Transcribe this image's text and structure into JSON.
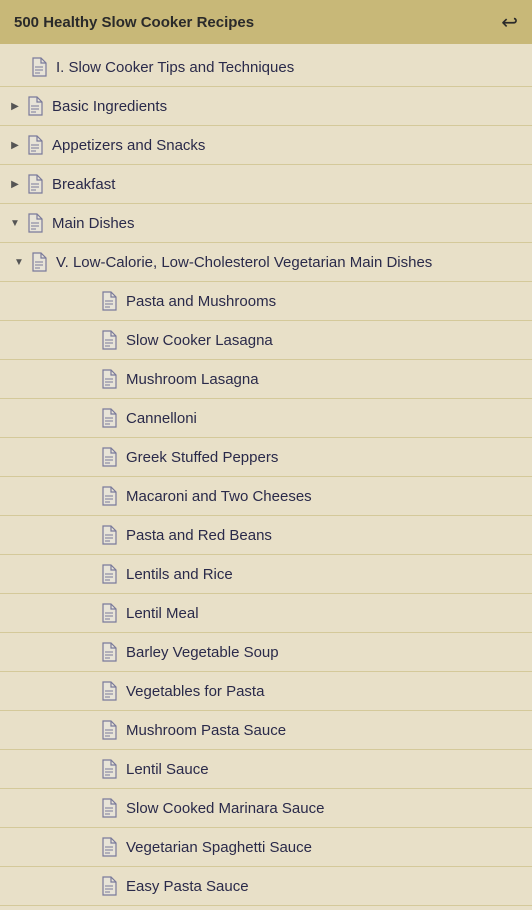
{
  "header": {
    "title": "500 Healthy Slow Cooker Recipes",
    "back_label": "↩"
  },
  "tree": [
    {
      "id": "tips",
      "label": "I. Slow Cooker Tips and Techniques",
      "indent": 1,
      "arrow": "none",
      "hasDoc": true
    },
    {
      "id": "basic-ingredients",
      "label": "Basic Ingredients",
      "indent": 0,
      "arrow": "right",
      "hasDoc": true
    },
    {
      "id": "appetizers",
      "label": "Appetizers and Snacks",
      "indent": 0,
      "arrow": "right",
      "hasDoc": true
    },
    {
      "id": "breakfast",
      "label": "Breakfast",
      "indent": 0,
      "arrow": "right",
      "hasDoc": true
    },
    {
      "id": "main-dishes",
      "label": "Main Dishes",
      "indent": 0,
      "arrow": "down",
      "hasDoc": true
    },
    {
      "id": "vegetarian-main",
      "label": "V. Low-Calorie, Low-Cholesterol Vegetarian Main Dishes",
      "indent": 1,
      "arrow": "down",
      "hasDoc": true
    },
    {
      "id": "pasta-mushrooms",
      "label": "Pasta and Mushrooms",
      "indent": 2,
      "arrow": "none",
      "hasDoc": true
    },
    {
      "id": "slow-cooker-lasagna",
      "label": "Slow Cooker Lasagna",
      "indent": 2,
      "arrow": "none",
      "hasDoc": true
    },
    {
      "id": "mushroom-lasagna",
      "label": "Mushroom Lasagna",
      "indent": 2,
      "arrow": "none",
      "hasDoc": true
    },
    {
      "id": "cannelloni",
      "label": "Cannelloni",
      "indent": 2,
      "arrow": "none",
      "hasDoc": true
    },
    {
      "id": "greek-stuffed-peppers",
      "label": "Greek Stuffed Peppers",
      "indent": 2,
      "arrow": "none",
      "hasDoc": true
    },
    {
      "id": "macaroni-two-cheeses",
      "label": "Macaroni and Two Cheeses",
      "indent": 2,
      "arrow": "none",
      "hasDoc": true
    },
    {
      "id": "pasta-red-beans",
      "label": "Pasta and Red Beans",
      "indent": 2,
      "arrow": "none",
      "hasDoc": true
    },
    {
      "id": "lentils-rice",
      "label": "Lentils and Rice",
      "indent": 2,
      "arrow": "none",
      "hasDoc": true
    },
    {
      "id": "lentil-meal",
      "label": "Lentil Meal",
      "indent": 2,
      "arrow": "none",
      "hasDoc": true
    },
    {
      "id": "barley-vegetable-soup",
      "label": "Barley Vegetable Soup",
      "indent": 2,
      "arrow": "none",
      "hasDoc": true
    },
    {
      "id": "vegetables-pasta",
      "label": "Vegetables for Pasta",
      "indent": 2,
      "arrow": "none",
      "hasDoc": true
    },
    {
      "id": "mushroom-pasta-sauce",
      "label": "Mushroom Pasta Sauce",
      "indent": 2,
      "arrow": "none",
      "hasDoc": true
    },
    {
      "id": "lentil-sauce",
      "label": "Lentil Sauce",
      "indent": 2,
      "arrow": "none",
      "hasDoc": true
    },
    {
      "id": "slow-cooked-marinara",
      "label": "Slow Cooked Marinara Sauce",
      "indent": 2,
      "arrow": "none",
      "hasDoc": true
    },
    {
      "id": "vegetarian-spaghetti",
      "label": "Vegetarian Spaghetti Sauce",
      "indent": 2,
      "arrow": "none",
      "hasDoc": true
    },
    {
      "id": "easy-pasta-sauce",
      "label": "Easy Pasta Sauce",
      "indent": 2,
      "arrow": "none",
      "hasDoc": true
    }
  ]
}
